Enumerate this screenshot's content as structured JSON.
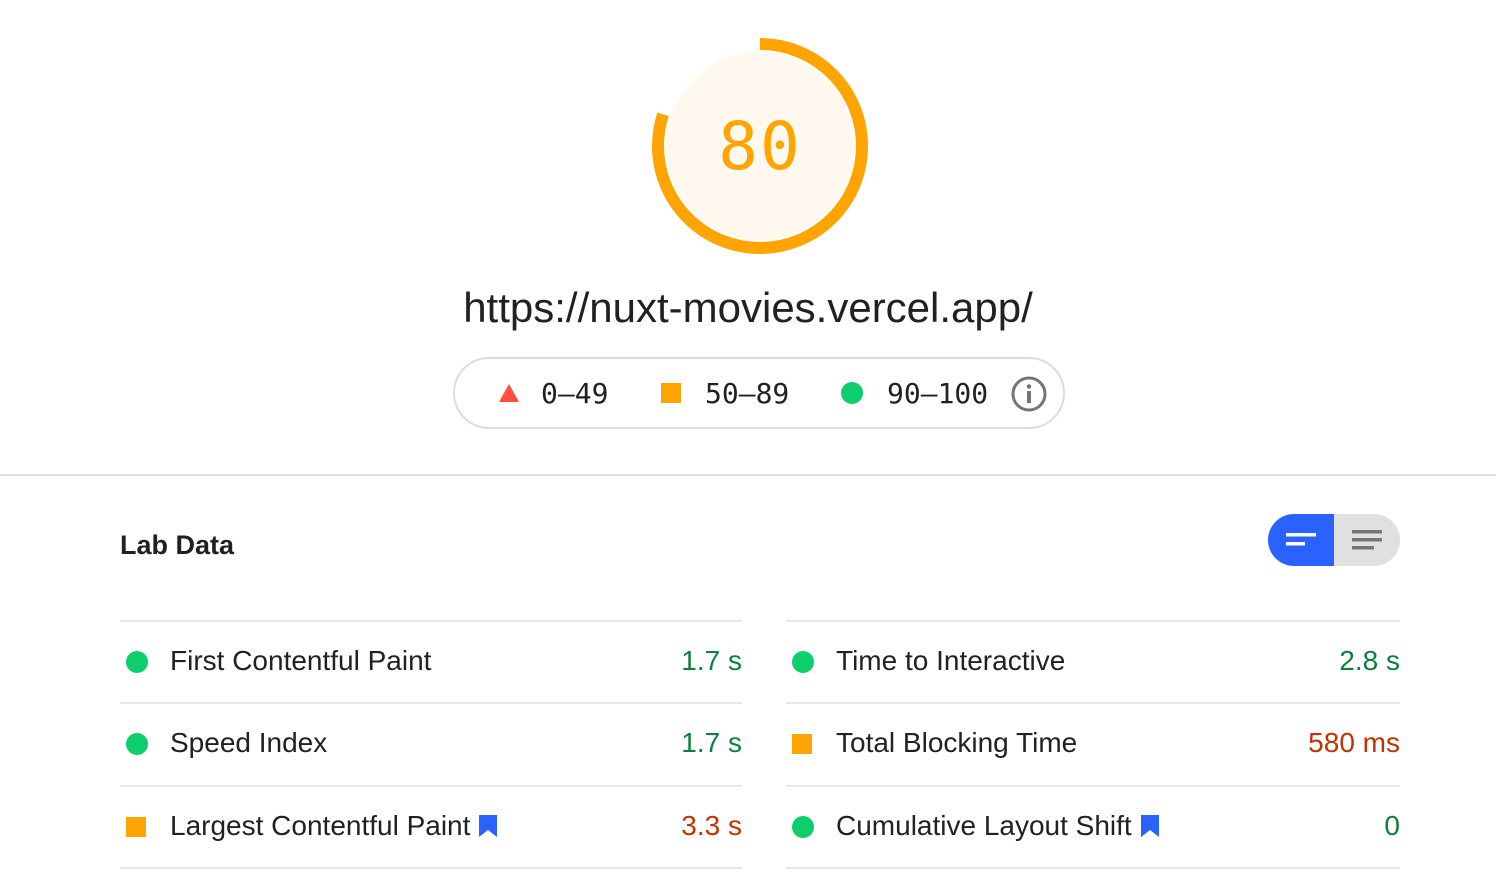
{
  "score": {
    "value": "80",
    "fraction": 0.8,
    "color": "#ffa400",
    "fill": "#fff8ee"
  },
  "url": "https://nuxt-movies.vercel.app/",
  "legend": {
    "fail": "0–49",
    "average": "50–89",
    "pass": "90–100",
    "info_icon": "info-icon"
  },
  "section_title": "Lab Data",
  "view_toggle": {
    "active": "bar-view",
    "inactive": "list-view"
  },
  "metrics": [
    {
      "label": "First Contentful Paint",
      "value": "1.7 s",
      "rating": "pass",
      "bookmark": false
    },
    {
      "label": "Time to Interactive",
      "value": "2.8 s",
      "rating": "pass",
      "bookmark": false
    },
    {
      "label": "Speed Index",
      "value": "1.7 s",
      "rating": "pass",
      "bookmark": false
    },
    {
      "label": "Total Blocking Time",
      "value": "580 ms",
      "rating": "average",
      "bookmark": false
    },
    {
      "label": "Largest Contentful Paint",
      "value": "3.3 s",
      "rating": "average",
      "bookmark": true
    },
    {
      "label": "Cumulative Layout Shift",
      "value": "0",
      "rating": "pass",
      "bookmark": true
    }
  ],
  "colors": {
    "pass": "#0cce6b",
    "average": "#ffa400",
    "fail": "#ff4e42",
    "accent": "#2962ff"
  }
}
